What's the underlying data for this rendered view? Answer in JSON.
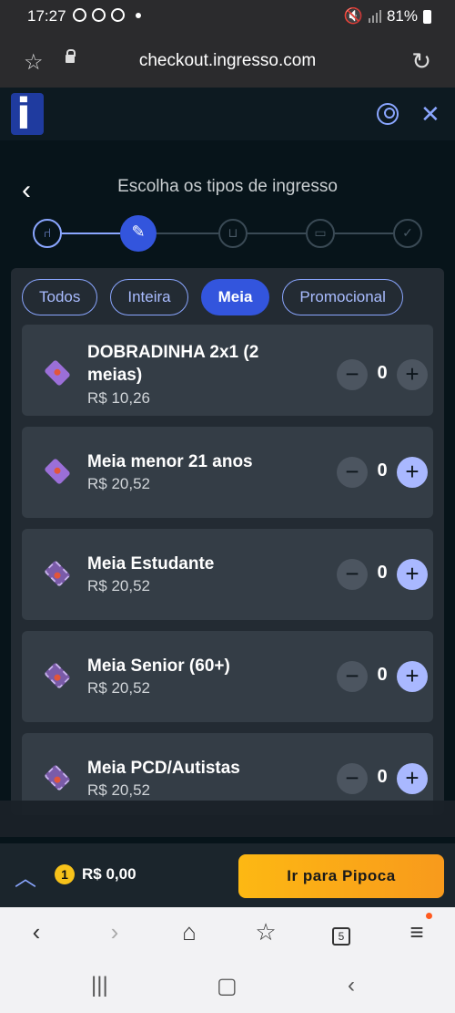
{
  "status": {
    "time": "17:27",
    "battery": "81%"
  },
  "browser": {
    "url": "checkout.ingresso.com"
  },
  "page": {
    "title": "Escolha os tipos de ingresso",
    "filters": [
      {
        "label": "Todos"
      },
      {
        "label": "Inteira"
      },
      {
        "label": "Meia"
      },
      {
        "label": "Promocional"
      }
    ],
    "active_filter": "Meia",
    "tickets": [
      {
        "name": "DOBRADINHA 2x1 (2 meias)",
        "price": "R$ 10,26",
        "qty": "0"
      },
      {
        "name": "Meia menor 21 anos",
        "price": "R$ 20,52",
        "qty": "0"
      },
      {
        "name": "Meia Estudante",
        "price": "R$ 20,52",
        "qty": "0"
      },
      {
        "name": "Meia Senior (60+)",
        "price": "R$ 20,52",
        "qty": "0"
      },
      {
        "name": "Meia PCD/Autistas",
        "price": "R$ 20,52",
        "qty": "0"
      }
    ]
  },
  "footer": {
    "count": "1",
    "total": "R$ 0,00",
    "cta": "Ir para Pipoca"
  },
  "browser_nav": {
    "tabs_count": "5"
  }
}
